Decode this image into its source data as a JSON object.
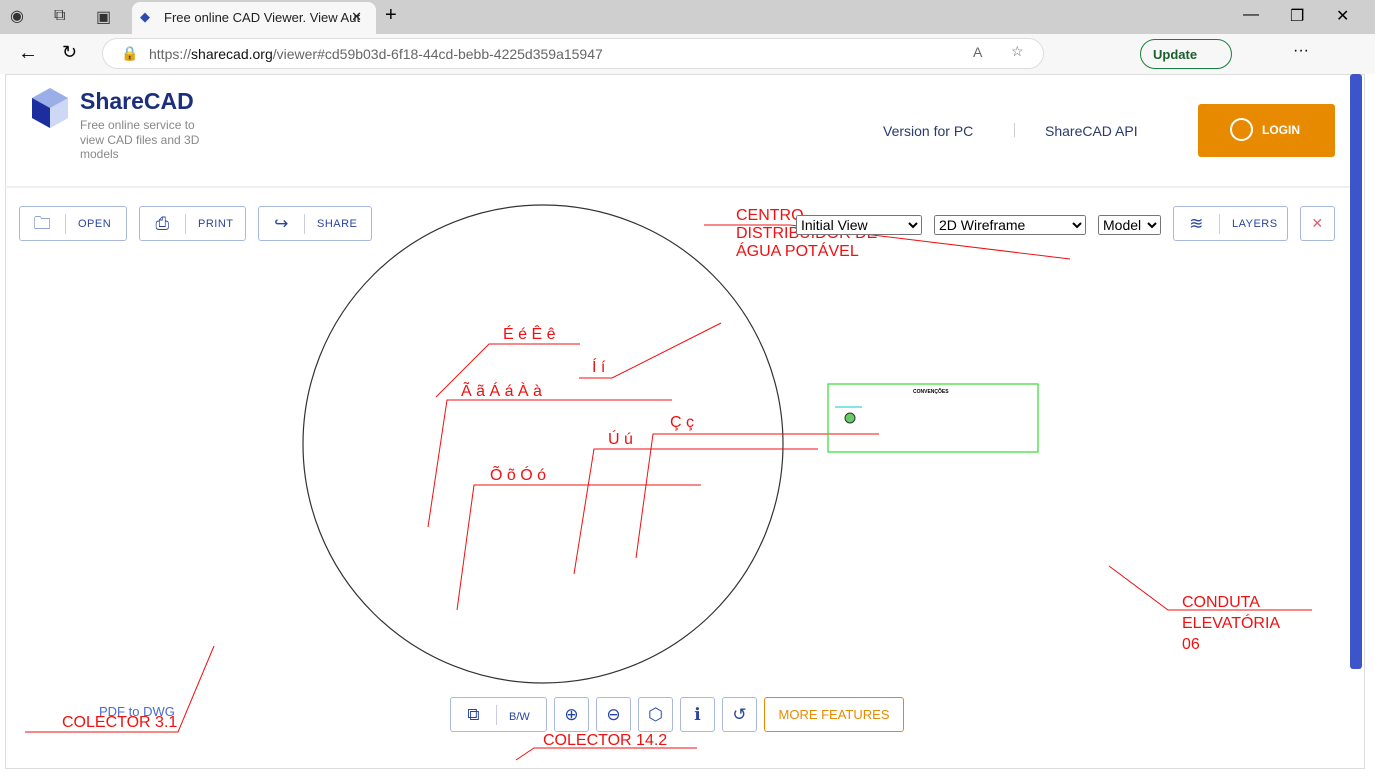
{
  "browser": {
    "tab_title": "Free online CAD Viewer. View Aut",
    "url_prefix": "https://",
    "url_domain": "sharecad.org",
    "url_path": "/viewer#cd59b03d-6f18-44cd-bebb-4225d359a15947",
    "update_label": "Update"
  },
  "header": {
    "brand": "ShareCAD",
    "tagline": "Free online service to view CAD files and 3D models",
    "nav": [
      "Version for PC",
      "ShareCAD API"
    ],
    "login": "LOGIN"
  },
  "toolbar": {
    "open": "OPEN",
    "print": "PRINT",
    "share": "SHARE",
    "view_select": "Initial View",
    "mode_select": "2D Wireframe",
    "space_select": "Model",
    "layers": "LAYERS"
  },
  "bottom": {
    "bw": "B/W",
    "more": "MORE FEATURES",
    "pdf_link": "PDF to DWG"
  },
  "drawing": {
    "labels": [
      "CENTRO",
      "DISTRIBUIDOR DE",
      "ÁGUA POTÁVEL",
      "É é Ê ê",
      "Í í",
      "Ã ã Á á À à",
      "Ç ç",
      "Ú ú",
      "Õ õ Ó ó",
      "CONDUTA",
      "ELEVATÓRIA",
      "06",
      "COLECTOR 3.1",
      "COLECTOR 14.2"
    ],
    "legend_title": "CONVENÇÕES"
  },
  "colors": {
    "accent": "#e88a00",
    "brand": "#1c2e7e",
    "cad_red": "#f01010",
    "legend_border": "#33dd33"
  }
}
